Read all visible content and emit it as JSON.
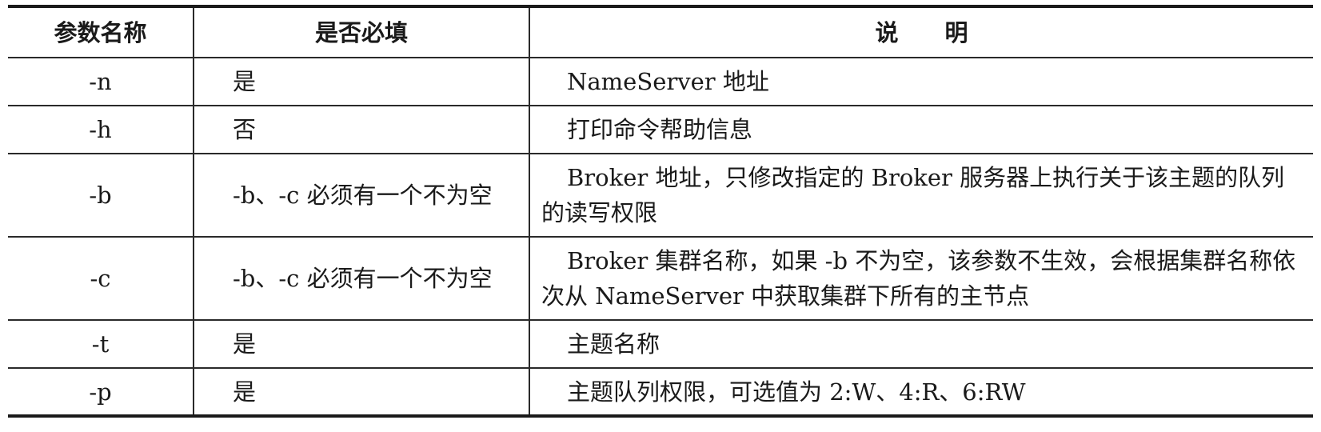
{
  "table": {
    "headers": {
      "param": "参数名称",
      "required": "是否必填",
      "description": "说明"
    },
    "rows": [
      {
        "param": "-n",
        "required": "是",
        "description": "NameServer 地址"
      },
      {
        "param": "-h",
        "required": "否",
        "description": "打印命令帮助信息"
      },
      {
        "param": "-b",
        "required": "-b、-c 必须有一个不为空",
        "description": "Broker 地址，只修改指定的 Broker 服务器上执行关于该主题的队列的读写权限"
      },
      {
        "param": "-c",
        "required": "-b、-c 必须有一个不为空",
        "description": "Broker 集群名称，如果 -b 不为空，该参数不生效，会根据集群名称依次从 NameServer 中获取集群下所有的主节点"
      },
      {
        "param": "-t",
        "required": "是",
        "description": "主题名称"
      },
      {
        "param": "-p",
        "required": "是",
        "description": "主题队列权限，可选值为 2:W、4:R、6:RW"
      }
    ]
  }
}
